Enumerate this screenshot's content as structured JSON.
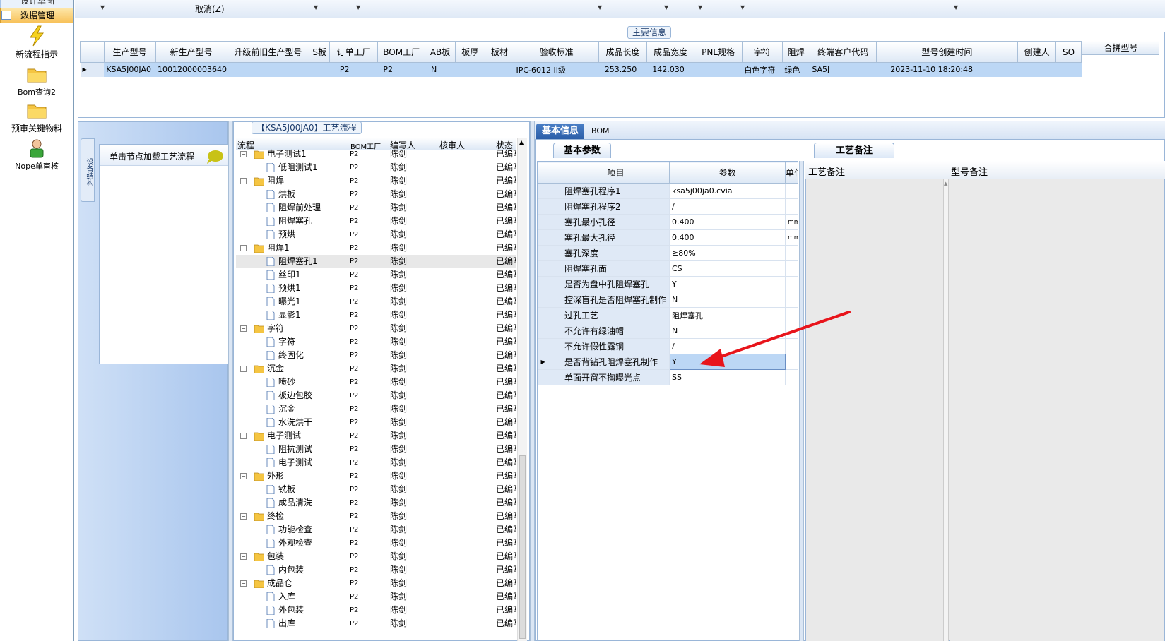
{
  "nav": {
    "tab_partial": "设计草图",
    "tab_active": "数据管理",
    "items": [
      {
        "label": "新流程指示",
        "icon": "lightning-icon"
      },
      {
        "label": "Bom查询2",
        "icon": "folder-icon"
      },
      {
        "label": "预审关键物料",
        "icon": "folder-icon"
      },
      {
        "label": "Nope单审核",
        "icon": "user-icon"
      }
    ]
  },
  "toolbar": {
    "cancel": "取消(Z)"
  },
  "main_info": {
    "caption": "主要信息",
    "columns": [
      "生产型号",
      "新生产型号",
      "升级前旧生产型号",
      "S板",
      "订单工厂",
      "BOM工厂",
      "AB板",
      "板厚",
      "板材",
      "验收标准",
      "成品长度",
      "成品宽度",
      "PNL规格",
      "字符",
      "阻焊",
      "终端客户代码",
      "型号创建时间",
      "创建人",
      "SO"
    ],
    "row": [
      "KSA5J00JA0",
      "10012000003640",
      "",
      "",
      "P2",
      "P2",
      "N",
      "",
      "",
      "IPC-6012 II级",
      "253.250",
      "142.030",
      "",
      "白色字符",
      "绿色",
      "SA5J",
      "2023-11-10 18:20:48",
      "",
      ""
    ],
    "right_header": "合拼型号"
  },
  "left_panel": {
    "side_tab": "设备结构",
    "node_hint": "单击节点加载工艺流程"
  },
  "flow": {
    "caption": "【KSA5J00JA0】工艺流程",
    "headers": {
      "flow": "流程",
      "bom": "BOM工厂",
      "editor": "编写人",
      "reviewer": "核审人",
      "status": "状态"
    },
    "rows": [
      {
        "name": "电子测试1",
        "level": 0,
        "bom": "P2",
        "editor": "陈剑",
        "status": "已编写"
      },
      {
        "name": "低阻测试1",
        "level": 1,
        "bom": "P2",
        "editor": "陈剑",
        "status": "已编写"
      },
      {
        "name": "阻焊",
        "level": 0,
        "bom": "P2",
        "editor": "陈剑",
        "status": "已编写"
      },
      {
        "name": "烘板",
        "level": 1,
        "bom": "P2",
        "editor": "陈剑",
        "status": "已编写"
      },
      {
        "name": "阻焊前处理",
        "level": 1,
        "bom": "P2",
        "editor": "陈剑",
        "status": "已编写"
      },
      {
        "name": "阻焊塞孔",
        "level": 1,
        "bom": "P2",
        "editor": "陈剑",
        "status": "已编写"
      },
      {
        "name": "预烘",
        "level": 1,
        "bom": "P2",
        "editor": "陈剑",
        "status": "已编写"
      },
      {
        "name": "阻焊1",
        "level": 0,
        "bom": "P2",
        "editor": "陈剑",
        "status": "已编写"
      },
      {
        "name": "阻焊塞孔1",
        "level": 1,
        "bom": "P2",
        "editor": "陈剑",
        "status": "已编写",
        "selected": true
      },
      {
        "name": "丝印1",
        "level": 1,
        "bom": "P2",
        "editor": "陈剑",
        "status": "已编写"
      },
      {
        "name": "预烘1",
        "level": 1,
        "bom": "P2",
        "editor": "陈剑",
        "status": "已编写"
      },
      {
        "name": "曝光1",
        "level": 1,
        "bom": "P2",
        "editor": "陈剑",
        "status": "已编写"
      },
      {
        "name": "显影1",
        "level": 1,
        "bom": "P2",
        "editor": "陈剑",
        "status": "已编写"
      },
      {
        "name": "字符",
        "level": 0,
        "bom": "P2",
        "editor": "陈剑",
        "status": "已编写"
      },
      {
        "name": "字符",
        "level": 1,
        "bom": "P2",
        "editor": "陈剑",
        "status": "已编写"
      },
      {
        "name": "终固化",
        "level": 1,
        "bom": "P2",
        "editor": "陈剑",
        "status": "已编写"
      },
      {
        "name": "沉金",
        "level": 0,
        "bom": "P2",
        "editor": "陈剑",
        "status": "已编写"
      },
      {
        "name": "喷砂",
        "level": 1,
        "bom": "P2",
        "editor": "陈剑",
        "status": "已编写"
      },
      {
        "name": "板边包胶",
        "level": 1,
        "bom": "P2",
        "editor": "陈剑",
        "status": "已编写"
      },
      {
        "name": "沉金",
        "level": 1,
        "bom": "P2",
        "editor": "陈剑",
        "status": "已编写"
      },
      {
        "name": "水洗烘干",
        "level": 1,
        "bom": "P2",
        "editor": "陈剑",
        "status": "已编写"
      },
      {
        "name": "电子测试",
        "level": 0,
        "bom": "P2",
        "editor": "陈剑",
        "status": "已编写"
      },
      {
        "name": "阻抗测试",
        "level": 1,
        "bom": "P2",
        "editor": "陈剑",
        "status": "已编写"
      },
      {
        "name": "电子测试",
        "level": 1,
        "bom": "P2",
        "editor": "陈剑",
        "status": "已编写"
      },
      {
        "name": "外形",
        "level": 0,
        "bom": "P2",
        "editor": "陈剑",
        "status": "已编写"
      },
      {
        "name": "铣板",
        "level": 1,
        "bom": "P2",
        "editor": "陈剑",
        "status": "已编写"
      },
      {
        "name": "成品清洗",
        "level": 1,
        "bom": "P2",
        "editor": "陈剑",
        "status": "已编写"
      },
      {
        "name": "终检",
        "level": 0,
        "bom": "P2",
        "editor": "陈剑",
        "status": "已编写"
      },
      {
        "name": "功能检查",
        "level": 1,
        "bom": "P2",
        "editor": "陈剑",
        "status": "已编写"
      },
      {
        "name": "外观检查",
        "level": 1,
        "bom": "P2",
        "editor": "陈剑",
        "status": "已编写"
      },
      {
        "name": "包装",
        "level": 0,
        "bom": "P2",
        "editor": "陈剑",
        "status": "已编写"
      },
      {
        "name": "内包装",
        "level": 1,
        "bom": "P2",
        "editor": "陈剑",
        "status": "已编写"
      },
      {
        "name": "成品仓",
        "level": 0,
        "bom": "P2",
        "editor": "陈剑",
        "status": "已编写"
      },
      {
        "name": "入库",
        "level": 1,
        "bom": "P2",
        "editor": "陈剑",
        "status": "已编写"
      },
      {
        "name": "外包装",
        "level": 1,
        "bom": "P2",
        "editor": "陈剑",
        "status": "已编写"
      },
      {
        "name": "出库",
        "level": 1,
        "bom": "P2",
        "editor": "陈剑",
        "status": "已编写"
      }
    ]
  },
  "basic_info": {
    "tab_basic": "基本信息",
    "tab_bom": "BOM",
    "subtab_params": "基本参数",
    "subtab_notes": "工艺备注",
    "param_headers": {
      "item": "项目",
      "value": "参数",
      "unit": "单位"
    },
    "params": [
      {
        "item": "阻焊塞孔程序1",
        "value": "ksa5j00ja0.cvia",
        "unit": ""
      },
      {
        "item": "阻焊塞孔程序2",
        "value": "/",
        "unit": ""
      },
      {
        "item": "塞孔最小孔径",
        "value": "0.400",
        "unit": "mm"
      },
      {
        "item": "塞孔最大孔径",
        "value": "0.400",
        "unit": "mm"
      },
      {
        "item": "塞孔深度",
        "value": "≥80%",
        "unit": ""
      },
      {
        "item": "阻焊塞孔面",
        "value": "CS",
        "unit": ""
      },
      {
        "item": "是否为盘中孔阻焊塞孔",
        "value": "Y",
        "unit": ""
      },
      {
        "item": "控深盲孔是否阻焊塞孔制作",
        "value": "N",
        "unit": ""
      },
      {
        "item": "过孔工艺",
        "value": "阻焊塞孔",
        "unit": ""
      },
      {
        "item": "不允许有绿油帽",
        "value": "N",
        "unit": ""
      },
      {
        "item": "不允许假性露铜",
        "value": "/",
        "unit": ""
      },
      {
        "item": "是否背钻孔阻焊塞孔制作",
        "value": "Y",
        "unit": "",
        "current": true
      },
      {
        "item": "单面开窗不掏曝光点",
        "value": "SS",
        "unit": ""
      }
    ],
    "notes_headers": {
      "process_note": "工艺备注",
      "model_note": "型号备注"
    }
  },
  "colors": {
    "accent": "#2b5ea8",
    "selection": "#bcd7f5",
    "arrow": "#e8141b",
    "folder": "#f5c542"
  }
}
